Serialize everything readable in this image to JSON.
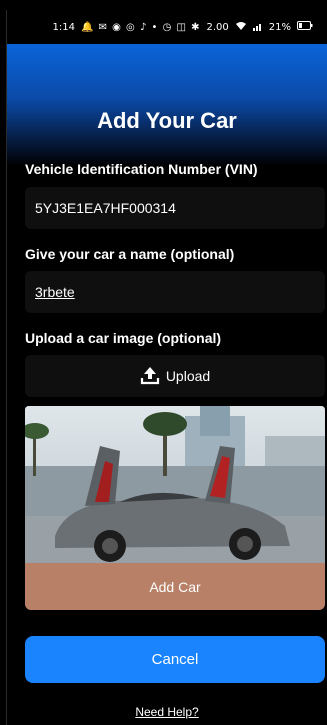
{
  "status_bar": {
    "time": "1:14",
    "icons_text": "🔔 ✉ ◉ ◎ ♪ •  ◷ ◫ ✱",
    "net_speed": "2.00",
    "battery": "21%"
  },
  "screen": {
    "title": "Add Your Car"
  },
  "vin": {
    "label": "Vehicle Identification Number (VIN)",
    "value": "5YJ3E1EA7HF000314"
  },
  "car_name": {
    "label": "Give your car a name (optional)",
    "value": "3rbete"
  },
  "image_upload": {
    "label": "Upload a car image (optional)",
    "button_label": "Upload",
    "icon": "upload-icon"
  },
  "actions": {
    "add_car_label": "Add Car",
    "cancel_label": "Cancel",
    "help_label": "Need Help?"
  },
  "colors": {
    "header_gradient_top": "#0a64d9",
    "add_car_button": "#b98068",
    "cancel_button": "#1a84ff",
    "field_background": "#0f0f0f"
  }
}
